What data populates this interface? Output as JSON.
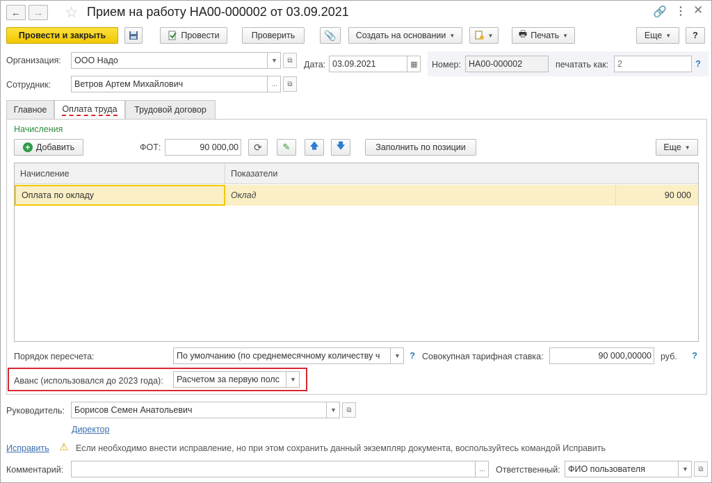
{
  "window": {
    "title": "Прием на работу НА00-000002 от 03.09.2021",
    "nav_back": "←",
    "nav_forward": "→"
  },
  "toolbar": {
    "post_close": "Провести и закрыть",
    "post": "Провести",
    "check": "Проверить",
    "create_based": "Создать на основании",
    "print": "Печать",
    "more": "Еще",
    "help": "?"
  },
  "header": {
    "org_label": "Организация:",
    "org_value": "ООО Надо",
    "date_label": "Дата:",
    "date_value": "03.09.2021",
    "number_label": "Номер:",
    "number_value": "НА00-000002",
    "print_as_label": "печатать как:",
    "print_as_placeholder": "2",
    "employee_label": "Сотрудник:",
    "employee_value": "Ветров Артем Михайлович"
  },
  "tabs": [
    {
      "label": "Главное"
    },
    {
      "label": "Оплата труда"
    },
    {
      "label": "Трудовой договор"
    }
  ],
  "accruals": {
    "section_title": "Начисления",
    "add_label": "Добавить",
    "fot_label": "ФОТ:",
    "fot_value": "90 000,00",
    "fill_label": "Заполнить по позиции",
    "more": "Еще",
    "columns": [
      "Начисление",
      "Показатели"
    ],
    "rows": [
      {
        "accrual": "Оплата по окладу",
        "indicator": "Оклад",
        "value": "90 000"
      }
    ]
  },
  "recalc": {
    "label": "Порядок пересчета:",
    "value": "По умолчанию (по среднемесячному количеству ч",
    "rate_label": "Совокупная тарифная ставка:",
    "rate_value": "90 000,00000",
    "currency": "руб."
  },
  "advance": {
    "label": "Аванс (использовался до 2023 года):",
    "value": "Расчетом за первую полс"
  },
  "manager": {
    "label": "Руководитель:",
    "value": "Борисов Семен Анатольевич",
    "position_link": "Директор"
  },
  "fix": {
    "link": "Исправить",
    "message": "Если необходимо внести исправление, но при этом сохранить данный экземпляр документа, воспользуйтесь командой Исправить"
  },
  "footer": {
    "comment_label": "Комментарий:",
    "comment_value": "",
    "responsible_label": "Ответственный:",
    "responsible_value": "ФИО пользователя"
  },
  "colors": {
    "accent_yellow": "#f2c800",
    "row_highlight": "#fbefc5",
    "section_green": "#2e8b3e",
    "highlight_red": "#d9272e",
    "link_blue": "#3a6fb0"
  }
}
